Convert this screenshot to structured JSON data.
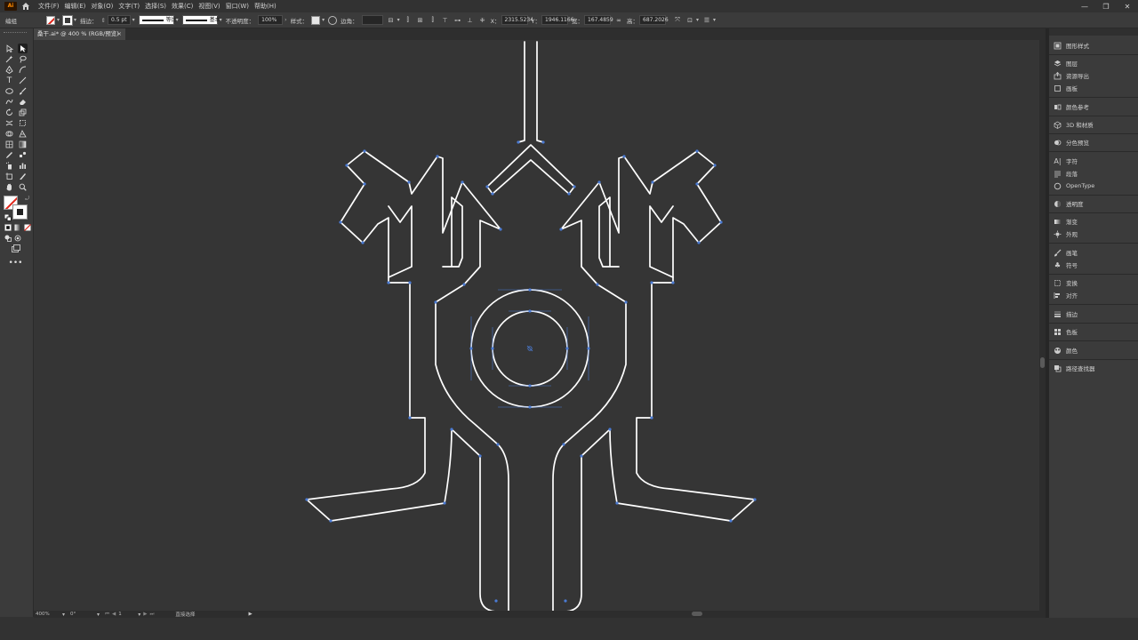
{
  "app": {
    "logo": "Ai"
  },
  "menu": [
    "文件(F)",
    "编辑(E)",
    "对象(O)",
    "文字(T)",
    "选择(S)",
    "效果(C)",
    "视图(V)",
    "窗口(W)",
    "帮助(H)"
  ],
  "window_controls": {
    "minimize": "—",
    "maximize": "❐",
    "close": "✕"
  },
  "control_bar": {
    "selection_label": "编组",
    "stroke_label": "描边：",
    "stroke_value": "0.5 pt",
    "profile_label": "等比",
    "brush_label": "基本",
    "opacity_label": "不透明度：",
    "opacity_value": "100%",
    "style_label": "样式：",
    "corner_label": "边角：",
    "x_label": "X：",
    "x_value": "2315.5234",
    "y_label": "Y：",
    "y_value": "1946.1166",
    "w_label": "宽：",
    "w_value": "167.4859",
    "h_label": "高：",
    "h_value": "687.2026"
  },
  "document_tab": {
    "title": "桑干.ai* @ 400 % (RGB/预览)",
    "close": "×"
  },
  "status_bar": {
    "zoom": "400%",
    "rotation": "0°",
    "artboard": "1",
    "tool_name": "直接选择"
  },
  "panels": [
    {
      "label": "图形样式",
      "icon": "graphic-styles-icon"
    },
    {
      "label": "图层",
      "icon": "layers-icon"
    },
    {
      "label": "资源导出",
      "icon": "asset-export-icon"
    },
    {
      "label": "画板",
      "icon": "artboards-icon"
    },
    {
      "label": "颜色参考",
      "icon": "color-guide-icon"
    },
    {
      "label": "3D 和材质",
      "icon": "3d-materials-icon"
    },
    {
      "label": "分色预览",
      "icon": "separations-preview-icon"
    },
    {
      "label": "字符",
      "icon": "character-icon"
    },
    {
      "label": "段落",
      "icon": "paragraph-icon"
    },
    {
      "label": "OpenType",
      "icon": "opentype-icon"
    },
    {
      "label": "透明度",
      "icon": "transparency-icon"
    },
    {
      "label": "渐变",
      "icon": "gradient-icon"
    },
    {
      "label": "外观",
      "icon": "appearance-icon"
    },
    {
      "label": "画笔",
      "icon": "brushes-icon"
    },
    {
      "label": "符号",
      "icon": "symbols-icon"
    },
    {
      "label": "变换",
      "icon": "transform-icon"
    },
    {
      "label": "对齐",
      "icon": "align-icon"
    },
    {
      "label": "描边",
      "icon": "stroke-icon"
    },
    {
      "label": "色板",
      "icon": "swatches-icon"
    },
    {
      "label": "颜色",
      "icon": "color-icon"
    },
    {
      "label": "路径查找器",
      "icon": "pathfinder-icon"
    }
  ],
  "colors": {
    "accent_selection": "#4b7bd4",
    "stroke": "#ffffff",
    "canvas": "#353535"
  }
}
